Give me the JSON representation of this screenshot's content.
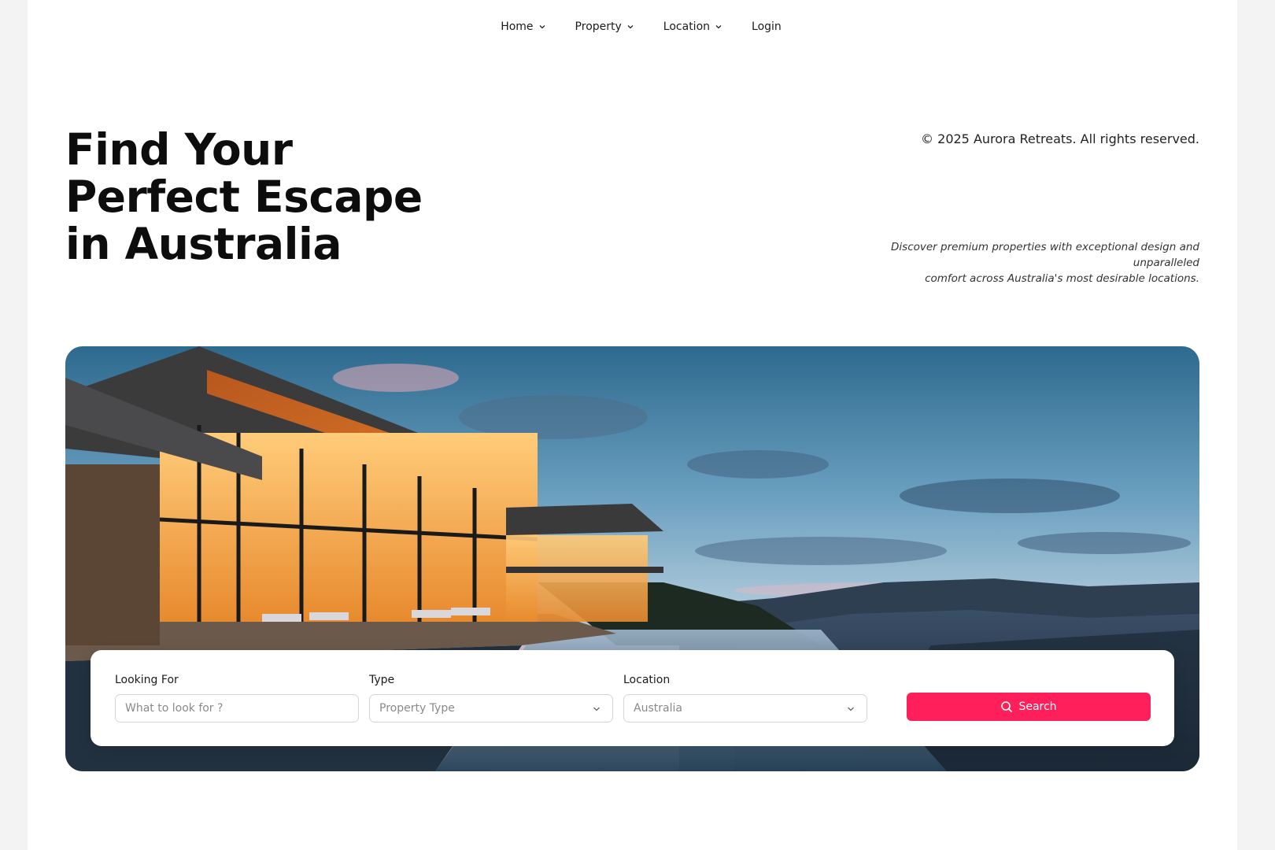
{
  "nav": {
    "items": [
      {
        "label": "Home",
        "has_dropdown": true
      },
      {
        "label": "Property",
        "has_dropdown": true
      },
      {
        "label": "Location",
        "has_dropdown": true
      },
      {
        "label": "Login",
        "has_dropdown": false
      }
    ]
  },
  "hero": {
    "title_line1": "Find Your",
    "title_line2": "Perfect Escape",
    "title_line3": "in Australia",
    "copyright": "© 2025 Aurora Retreats. All rights reserved.",
    "tagline_line1": "Discover premium properties with exceptional design and unparalleled",
    "tagline_line2": "comfort across Australia's most desirable locations."
  },
  "search": {
    "looking_for": {
      "label": "Looking For",
      "placeholder": "What to look for ?"
    },
    "type": {
      "label": "Type",
      "value": "Property Type"
    },
    "location": {
      "label": "Location",
      "value": "Australia"
    },
    "button_label": "Search"
  },
  "colors": {
    "accent": "#ff1f5a",
    "page_bg": "#ffffff",
    "outer_bg": "#f3f3f3"
  },
  "icons": {
    "nav_dropdown": "chevron-down-icon",
    "select_dropdown": "chevron-down-icon",
    "search": "search-icon"
  }
}
